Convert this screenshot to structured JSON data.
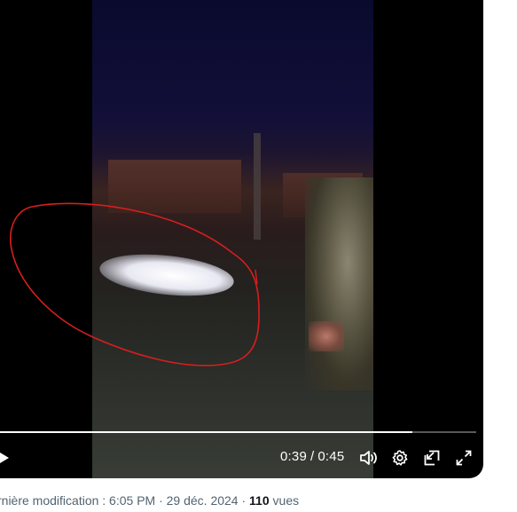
{
  "player": {
    "time_current": "0:39",
    "time_separator": "/",
    "time_total": "0:45",
    "progress": 0.866,
    "icons": {
      "play": "play-icon",
      "volume": "volume-icon",
      "settings": "gear-icon",
      "pip": "picture-in-picture-icon",
      "fullscreen": "fullscreen-icon"
    },
    "annotation_color": "#d81e1e"
  },
  "caption": {
    "modified_label": "rnière modification : 6:05 PM · 29 déc. 2024 · ",
    "views_count": "110",
    "views_label": "vues"
  }
}
